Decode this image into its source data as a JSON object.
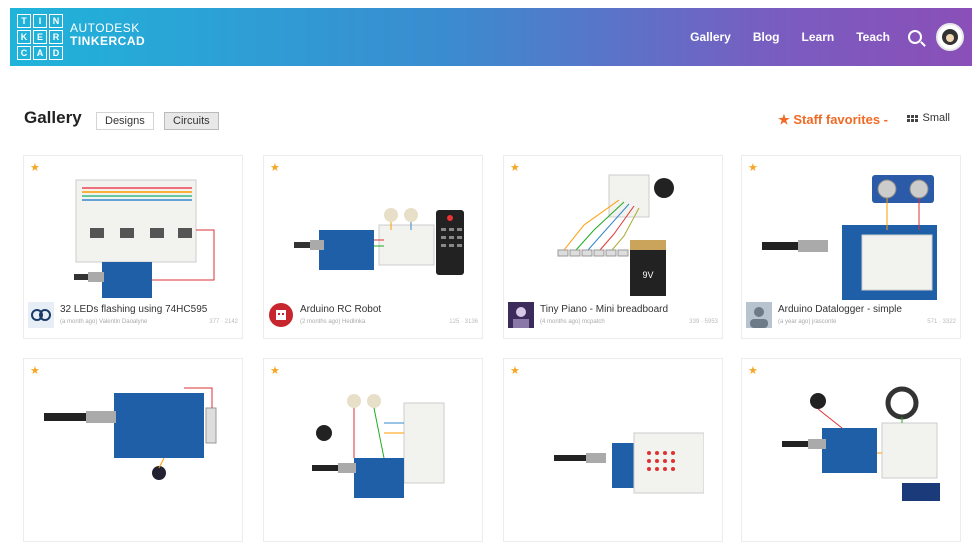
{
  "header": {
    "logo_letters": [
      "T",
      "I",
      "N",
      "K",
      "E",
      "R",
      "C",
      "A",
      "D"
    ],
    "brand_line1": "AUTODESK",
    "brand_line2": "TINKERCAD",
    "nav": [
      "Gallery",
      "Blog",
      "Learn",
      "Teach"
    ],
    "accent_gradient": [
      "#1fb4da",
      "#8a4fb8"
    ]
  },
  "toolbar": {
    "title": "Gallery",
    "filters": [
      "Designs",
      "Circuits"
    ],
    "active_filter": "Circuits",
    "sort_label": "★ Staff favorites -",
    "view_label": "Small",
    "sort_color": "#f06a25"
  },
  "cards": [
    {
      "title": "32 LEDs flashing using 74HC595",
      "meta": "(a month ago) Valentin Daoalyne",
      "stats": "377 · 2142",
      "icon": "circuit-logo-icon"
    },
    {
      "title": "Arduino RC Robot",
      "meta": "(2 months ago) Hedlinka",
      "stats": "125 · 3136",
      "icon": "robot-badge-icon"
    },
    {
      "title": "Tiny Piano - Mini breadboard",
      "meta": "(4 months ago) mcpatch",
      "stats": "339 · 5953",
      "icon": "user-photo-icon"
    },
    {
      "title": "Arduino Datalogger - simple",
      "meta": "(a year ago) jrasconte",
      "stats": "571 · 3322",
      "icon": "user-avatar-icon"
    },
    {
      "title": "",
      "meta": "",
      "stats": "",
      "icon": ""
    },
    {
      "title": "",
      "meta": "",
      "stats": "",
      "icon": ""
    },
    {
      "title": "",
      "meta": "",
      "stats": "",
      "icon": ""
    },
    {
      "title": "",
      "meta": "",
      "stats": "",
      "icon": ""
    }
  ],
  "battery_label": "9V"
}
